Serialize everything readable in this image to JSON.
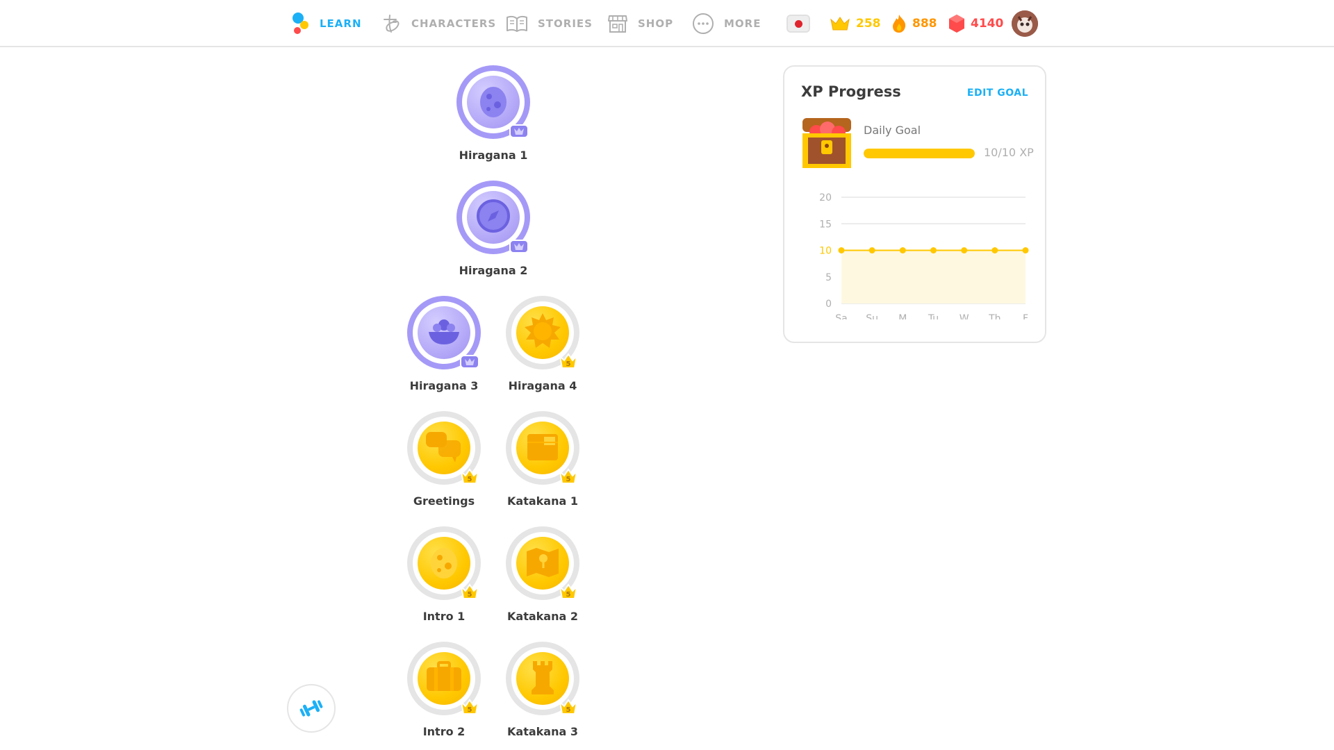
{
  "nav": {
    "items": [
      {
        "label": "LEARN",
        "icon": "owl-logo-icon"
      },
      {
        "label": "CHARACTERS",
        "icon": "hiragana-a-icon"
      },
      {
        "label": "STORIES",
        "icon": "book-icon"
      },
      {
        "label": "SHOP",
        "icon": "shop-icon"
      },
      {
        "label": "MORE",
        "icon": "more-dots-icon"
      }
    ],
    "language_flag": "japan-flag-icon",
    "crowns": "258",
    "streak": "888",
    "gems": "4140"
  },
  "skills": [
    {
      "name": "Hiragana 1",
      "state": "legendary",
      "icon": "egg-icon"
    },
    {
      "name": "Hiragana 2",
      "state": "legendary",
      "icon": "compass-icon"
    },
    {
      "name": "Hiragana 3",
      "state": "legendary",
      "icon": "flower-bowl-icon"
    },
    {
      "name": "Hiragana 4",
      "state": "gold",
      "level": "5",
      "icon": "sun-icon"
    },
    {
      "name": "Greetings",
      "state": "gold",
      "level": "5",
      "icon": "speech-bubbles-icon"
    },
    {
      "name": "Katakana 1",
      "state": "gold",
      "level": "5",
      "icon": "box-icon"
    },
    {
      "name": "Intro 1",
      "state": "gold",
      "level": "5",
      "icon": "egg-icon"
    },
    {
      "name": "Katakana 2",
      "state": "gold",
      "level": "5",
      "icon": "map-icon"
    },
    {
      "name": "Intro 2",
      "state": "gold",
      "level": "5",
      "icon": "suitcase-icon"
    },
    {
      "name": "Katakana 3",
      "state": "gold",
      "level": "5",
      "icon": "chess-rook-icon"
    }
  ],
  "xp_card": {
    "title": "XP Progress",
    "edit_goal": "EDIT GOAL",
    "daily_goal_label": "Daily Goal",
    "goal_progress_text": "10/10 XP",
    "goal_progress_fraction": 1.0
  },
  "chart_data": {
    "type": "line",
    "title": "",
    "x": [
      "Sa",
      "Su",
      "M",
      "Tu",
      "W",
      "Th",
      "F"
    ],
    "values": [
      10,
      10,
      10,
      10,
      10,
      10,
      10
    ],
    "y_ticks": [
      0,
      5,
      10,
      15,
      20
    ],
    "ylim": [
      0,
      20
    ],
    "goal": 10,
    "grid": true,
    "colors": {
      "line": "#ffc800",
      "fill": "#fff8e1",
      "grid": "#e5e5e5",
      "tick": "#afafaf"
    }
  },
  "colors": {
    "blue": "#1cb0f6",
    "gold": "#ffc800",
    "orange": "#ff9600",
    "red": "#ff4b4b",
    "purple": "#a599f7"
  }
}
